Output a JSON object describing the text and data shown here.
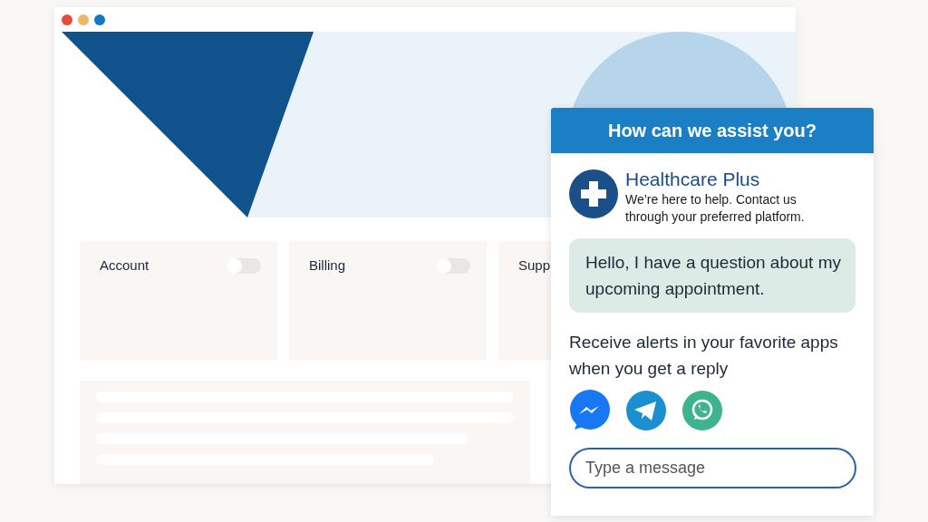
{
  "window": {
    "controls": [
      {
        "color": "#e9493a"
      },
      {
        "color": "#f2b766"
      },
      {
        "color": "#1478c8"
      }
    ]
  },
  "cards": [
    {
      "label": "Account",
      "on": false
    },
    {
      "label": "Billing",
      "on": false
    },
    {
      "label": "Supp"
    }
  ],
  "chat": {
    "header": "How can we assist you?",
    "brand": "Healthcare Plus",
    "tagline": "We’re here to help. Contact us through your preferred platform.",
    "message": "Hello, I have a question about my upcoming appointment.",
    "alerts": "Receive alerts in your favorite apps when you get a reply",
    "apps": [
      {
        "kind": "messenger"
      },
      {
        "kind": "telegram"
      },
      {
        "kind": "whatsapp"
      }
    ],
    "input": {
      "placeholder": "Type a message"
    }
  }
}
